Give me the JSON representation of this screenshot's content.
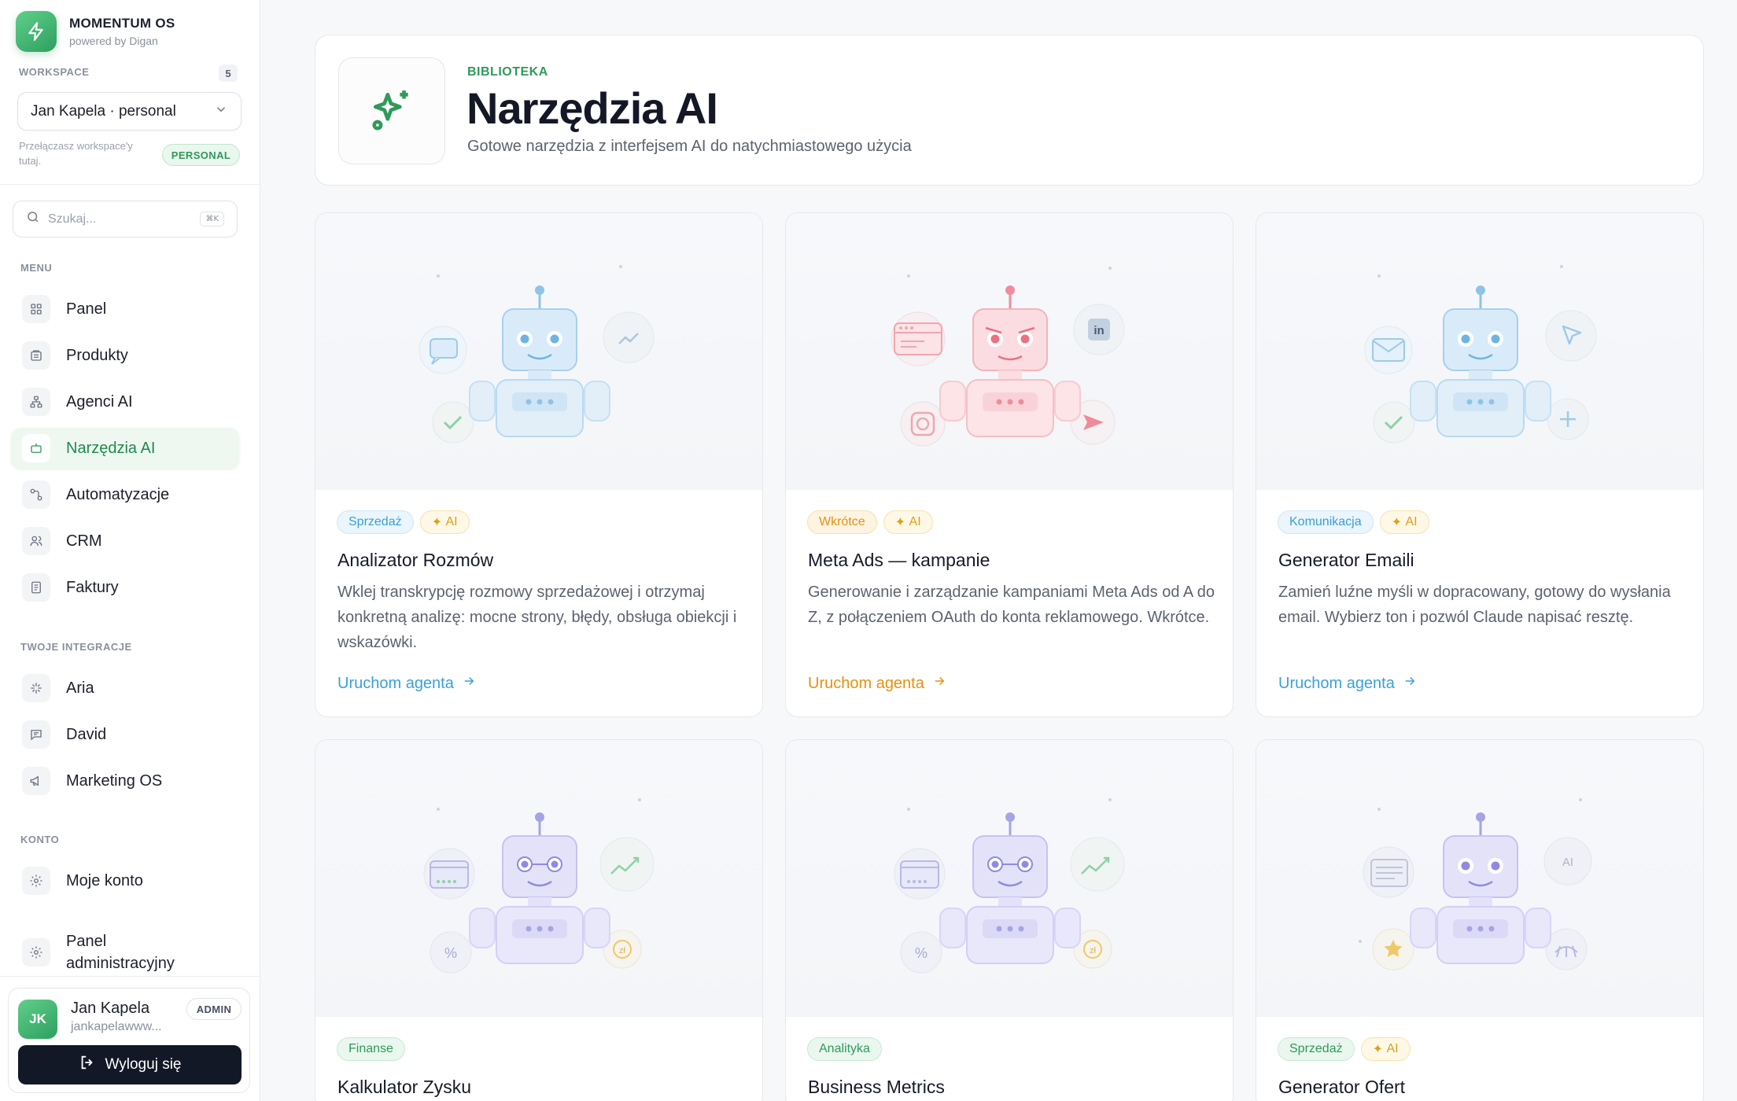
{
  "brand": {
    "name": "MOMENTUM OS",
    "subtitle": "powered by Digan"
  },
  "workspace": {
    "label": "WORKSPACE",
    "count": "5",
    "selected": "Jan Kapela · personal",
    "hint": "Przełączasz workspace'y tutaj.",
    "badge": "PERSONAL"
  },
  "search": {
    "placeholder": "Szukaj...",
    "shortcut": "⌘K"
  },
  "sidebar": {
    "menu_label": "MENU",
    "menu": [
      {
        "label": "Panel",
        "icon": "grid-icon"
      },
      {
        "label": "Produkty",
        "icon": "box-icon"
      },
      {
        "label": "Agenci AI",
        "icon": "network-icon"
      },
      {
        "label": "Narzędzia AI",
        "icon": "bot-icon",
        "active": true
      },
      {
        "label": "Automatyzacje",
        "icon": "workflow-icon"
      },
      {
        "label": "CRM",
        "icon": "users-icon"
      },
      {
        "label": "Faktury",
        "icon": "invoice-icon"
      }
    ],
    "integrations_label": "TWOJE INTEGRACJE",
    "integrations": [
      {
        "label": "Aria",
        "icon": "sparkle-icon"
      },
      {
        "label": "David",
        "icon": "chat-icon"
      },
      {
        "label": "Marketing OS",
        "icon": "megaphone-icon"
      }
    ],
    "account_label": "KONTO",
    "account": [
      {
        "label": "Moje konto",
        "icon": "gear-icon"
      },
      {
        "label": "Panel administracyjny",
        "icon": "gear-icon"
      }
    ]
  },
  "user": {
    "initials": "JK",
    "name": "Jan Kapela",
    "email": "jankapelawww...",
    "role": "ADMIN",
    "logout_label": "Wyloguj się"
  },
  "header": {
    "eyebrow": "BIBLIOTEKA",
    "title": "Narzędzia AI",
    "subtitle": "Gotowe narzędzia z interfejsem AI do natychmiastowego użycia"
  },
  "tools": [
    {
      "category": "Sprzedaż",
      "ai_tag": "AI",
      "theme": "blue",
      "title": "Analizator Rozmów",
      "description": "Wklej transkrypcję rozmowy sprzedażowej i otrzymaj konkretną analizę: mocne strony, błędy, obsługa obiekcji i wskazówki.",
      "cta": "Uruchom agenta",
      "colors": {
        "accent": "#3aa0d8",
        "tag_bg": "#eaf5fc",
        "tag_border": "#cfe6f5"
      }
    },
    {
      "category": "Wkrótce",
      "ai_tag": "AI",
      "theme": "red",
      "title": "Meta Ads — kampanie",
      "description": "Generowanie i zarządzanie kampaniami Meta Ads od A do Z, z połączeniem OAuth do konta reklamowego. Wkrótce.",
      "cta": "Uruchom agenta",
      "colors": {
        "accent": "#e6910f",
        "tag_bg": "#fff4e2",
        "tag_border": "#f7deb0"
      }
    },
    {
      "category": "Komunikacja",
      "ai_tag": "AI",
      "theme": "blue",
      "title": "Generator Emaili",
      "description": "Zamień luźne myśli w dopracowany, gotowy do wysłania email. Wybierz ton i pozwól Claude napisać resztę.",
      "cta": "Uruchom agenta",
      "colors": {
        "accent": "#3aa0d8",
        "tag_bg": "#eaf5fc",
        "tag_border": "#cfe6f5"
      }
    },
    {
      "category": "Finanse",
      "ai_tag": "",
      "theme": "purple",
      "title": "Kalkulator Zysku",
      "description": "",
      "cta": "",
      "colors": {
        "accent": "#2f9a59",
        "tag_bg": "#eaf7ef",
        "tag_border": "#c8e8d3"
      }
    },
    {
      "category": "Analityka",
      "ai_tag": "",
      "theme": "purple",
      "title": "Business Metrics",
      "description": "",
      "cta": "",
      "colors": {
        "accent": "#2f9a59",
        "tag_bg": "#eaf7ef",
        "tag_border": "#c8e8d3"
      }
    },
    {
      "category": "Sprzedaż",
      "ai_tag": "AI",
      "theme": "purple",
      "title": "Generator Ofert",
      "description": "",
      "cta": "",
      "colors": {
        "accent": "#2f9a59",
        "tag_bg": "#eaf7ef",
        "tag_border": "#c8e8d3"
      }
    }
  ],
  "art_labels": {
    "linkedin": "in",
    "currency": "zł",
    "percent": "%",
    "ai": "AI"
  }
}
